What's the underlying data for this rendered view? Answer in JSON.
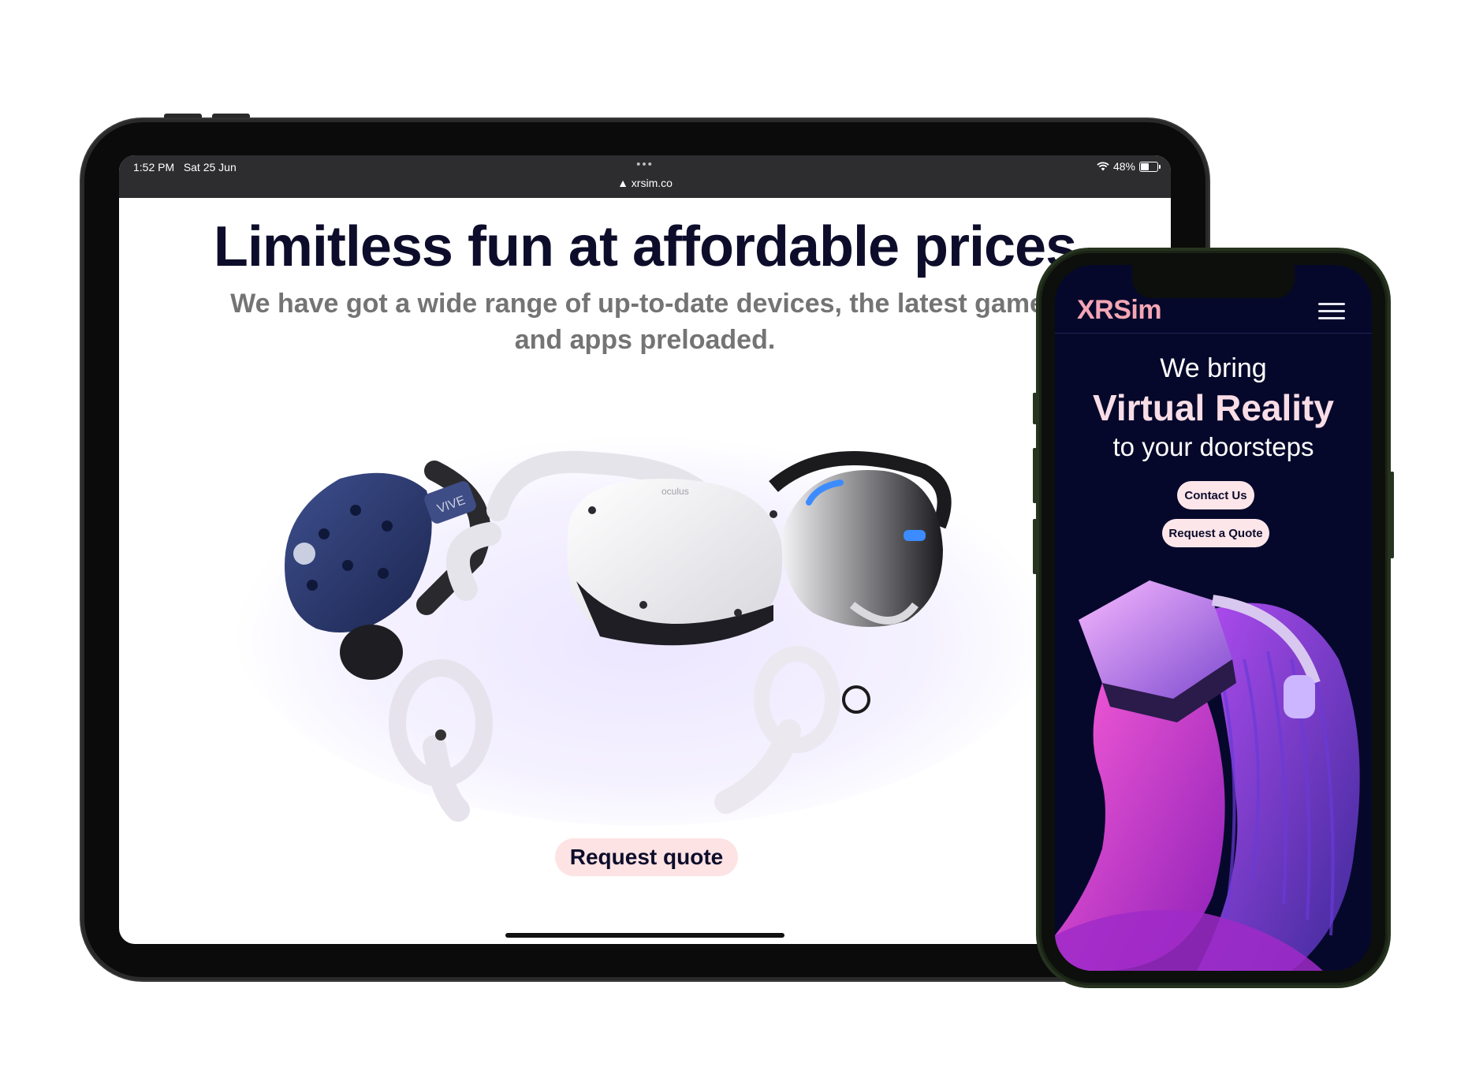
{
  "tablet": {
    "status_bar": {
      "time": "1:52 PM",
      "date": "Sat 25 Jun",
      "url": "▲ xrsim.co",
      "battery": "48%",
      "battery_level": 0.48,
      "icons": [
        "wifi-icon",
        "battery-icon",
        "more-dots-icon"
      ]
    },
    "hero": {
      "title": "Limitless fun at affordable prices",
      "subtitle": "We have got a wide range of up-to-date devices, the latest games and apps preloaded."
    },
    "product_labels": {
      "vive": "VIVE",
      "oculus": "oculus"
    },
    "cta_label": "Request quote"
  },
  "phone": {
    "logo": "XRSim",
    "hero": {
      "line1": "We bring",
      "line2": "Virtual Reality",
      "line3": "to your doorsteps"
    },
    "buttons": {
      "contact": "Contact Us",
      "quote": "Request a Quote"
    }
  },
  "colors": {
    "heading": "#0d0d2b",
    "subtitle": "#747474",
    "cta_bg": "#fde3e3",
    "phone_bg": "#06082b",
    "logo": "#f4a6b4",
    "accent_magenta": "#c13cff",
    "accent_blue": "#3c6cff"
  }
}
